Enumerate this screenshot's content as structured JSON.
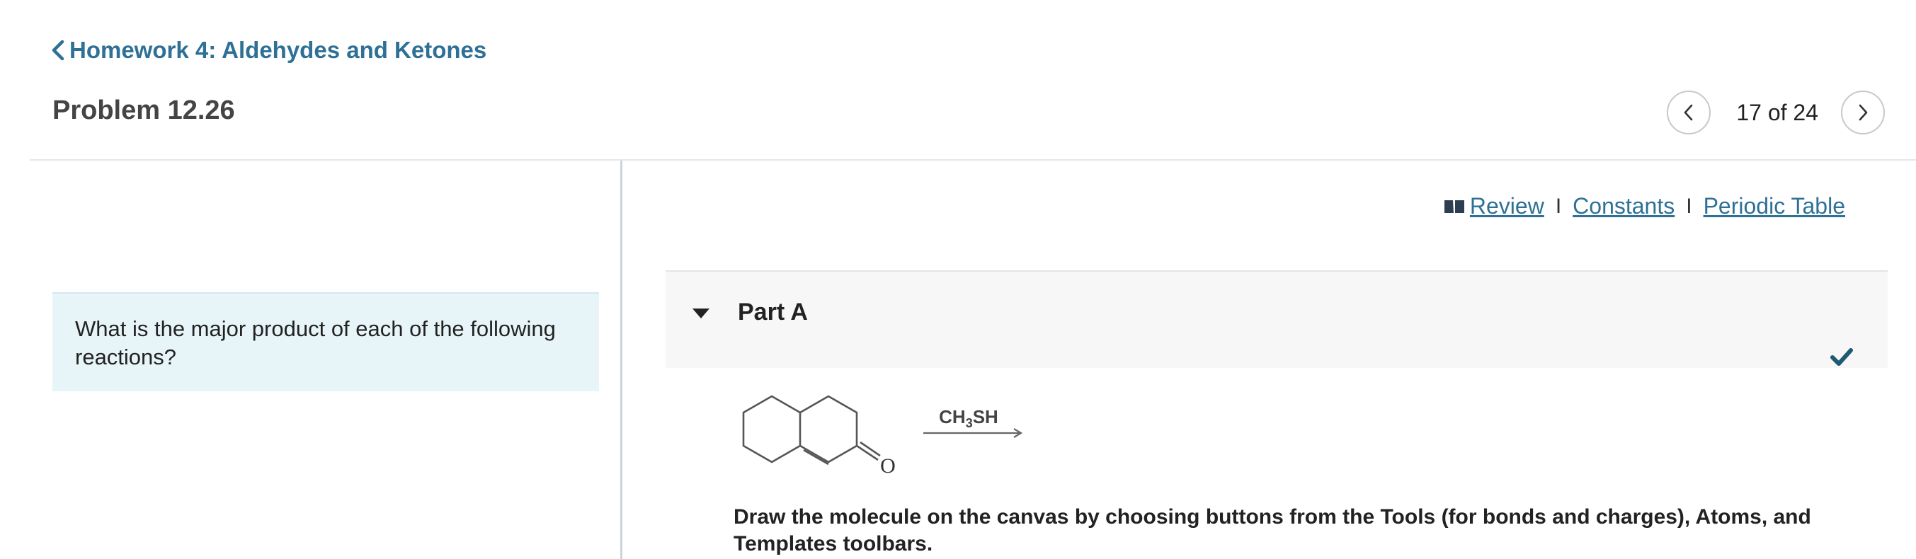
{
  "header": {
    "back_link": "Homework 4: Aldehydes and Ketones",
    "problem_title": "Problem 12.26",
    "pager": {
      "count_text": "17 of 24"
    }
  },
  "question": {
    "text": "What is the major product of each of the following reactions?"
  },
  "resources": {
    "review": "Review",
    "constants": "Constants",
    "periodic_table": "Periodic Table",
    "separator": "I"
  },
  "part": {
    "title": "Part A",
    "status": "check-icon"
  },
  "reaction": {
    "reagent_main": "CH",
    "reagent_sub": "3",
    "reagent_tail": "SH",
    "oxygen_label": "O"
  },
  "instructions": "Draw the molecule on the canvas by choosing buttons from the Tools (for bonds and charges), Atoms, and Templates toolbars.",
  "colors": {
    "link": "#2e7096",
    "question_bg": "#e8f5f8",
    "check": "#1f5a73"
  }
}
